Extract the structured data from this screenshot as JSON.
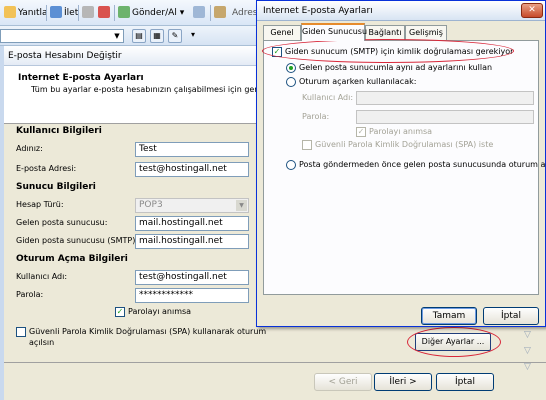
{
  "toolbar": {
    "reply_label": "Yanıtla",
    "forward_label": "İlet",
    "send_receive_label": "Gönder/Al",
    "address_label": "Adres"
  },
  "account_dialog": {
    "title": "E-posta Hesabını Değiştir",
    "header_title": "Internet E-posta Ayarları",
    "header_subtitle": "Tüm bu ayarlar e-posta hesabınızın çalışabilmesi için gereklidir.",
    "user_section": "Kullanıcı Bilgileri",
    "name_label": "Adınız:",
    "name_value": "Test",
    "email_label": "E-posta Adresi:",
    "email_value": "test@hostingall.net",
    "server_section": "Sunucu Bilgileri",
    "account_type_label": "Hesap Türü:",
    "account_type_value": "POP3",
    "incoming_label": "Gelen posta sunucusu:",
    "incoming_value": "mail.hostingall.net",
    "outgoing_label": "Giden posta sunucusu (SMTP):",
    "outgoing_value": "mail.hostingall.net",
    "login_section": "Oturum Açma Bilgileri",
    "username_label": "Kullanıcı Adı:",
    "username_value": "test@hostingall.net",
    "password_label": "Parola:",
    "password_value": "************",
    "remember_label": "Parolayı anımsa",
    "spa_label_line1": "Güvenli Parola Kimlik Doğrulaması (SPA) kullanarak oturum",
    "spa_label_line2": "açılsın",
    "more_settings_button": "Diğer Ayarlar ...",
    "back_button": "< Geri",
    "next_button": "İleri >",
    "cancel_button": "İptal"
  },
  "settings_dialog": {
    "title": "Internet E-posta Ayarları",
    "close_glyph": "✕",
    "tabs": [
      "Genel",
      "Giden Sunucusu",
      "Bağlantı",
      "Gelişmiş"
    ],
    "active_tab": "Giden Sunucusu",
    "smtp_auth_label": "Giden sunucum (SMTP) için kimlik doğrulaması gerekiyor",
    "same_settings_label": "Gelen posta sunucumla aynı ad ayarlarını kullan",
    "login_using_label": "Oturum açarken kullanılacak:",
    "username_label": "Kullanıcı Adı:",
    "password_label": "Parola:",
    "remember_label": "Parolayı anımsa",
    "spa_label": "Güvenli Parola Kimlik Doğrulaması (SPA) iste",
    "login_before_label": "Posta göndermeden önce gelen posta sunucusunda oturum aç",
    "ok_button": "Tamam",
    "cancel_button": "İptal"
  },
  "colors": {
    "highlight_circle": "#d8283a",
    "check_mark": "#21a121",
    "dialog_bg": "#ece9d8"
  }
}
